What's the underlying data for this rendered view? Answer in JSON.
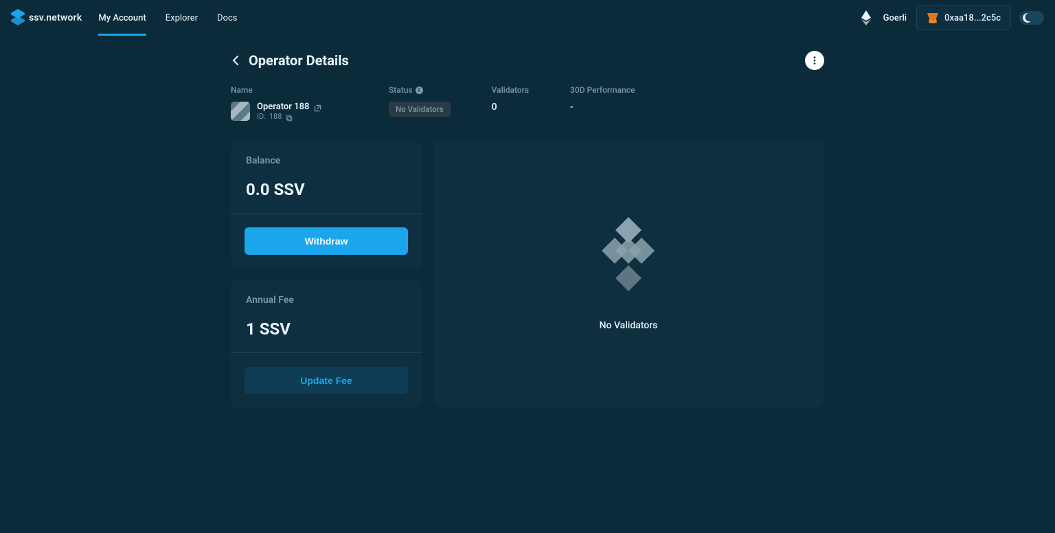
{
  "brand": {
    "name": "ssv.network"
  },
  "nav": {
    "items": [
      {
        "label": "My Account",
        "active": true
      },
      {
        "label": "Explorer",
        "active": false
      },
      {
        "label": "Docs",
        "active": false
      }
    ]
  },
  "network": {
    "label": "Goerli"
  },
  "wallet": {
    "address_short": "0xaa18...2c5c"
  },
  "page": {
    "title": "Operator Details"
  },
  "stats": {
    "name_label": "Name",
    "operator_name": "Operator 188",
    "operator_id_prefix": "ID: ",
    "operator_id": "188",
    "status_label": "Status",
    "status_value": "No Validators",
    "validators_label": "Validators",
    "validators_value": "0",
    "perf_label": "30D Performance",
    "perf_value": "-"
  },
  "balance": {
    "title": "Balance",
    "value": "0.0 SSV",
    "withdraw_label": "Withdraw"
  },
  "fee": {
    "title": "Annual Fee",
    "value": "1 SSV",
    "update_label": "Update Fee"
  },
  "validators_panel": {
    "empty_text": "No Validators"
  }
}
